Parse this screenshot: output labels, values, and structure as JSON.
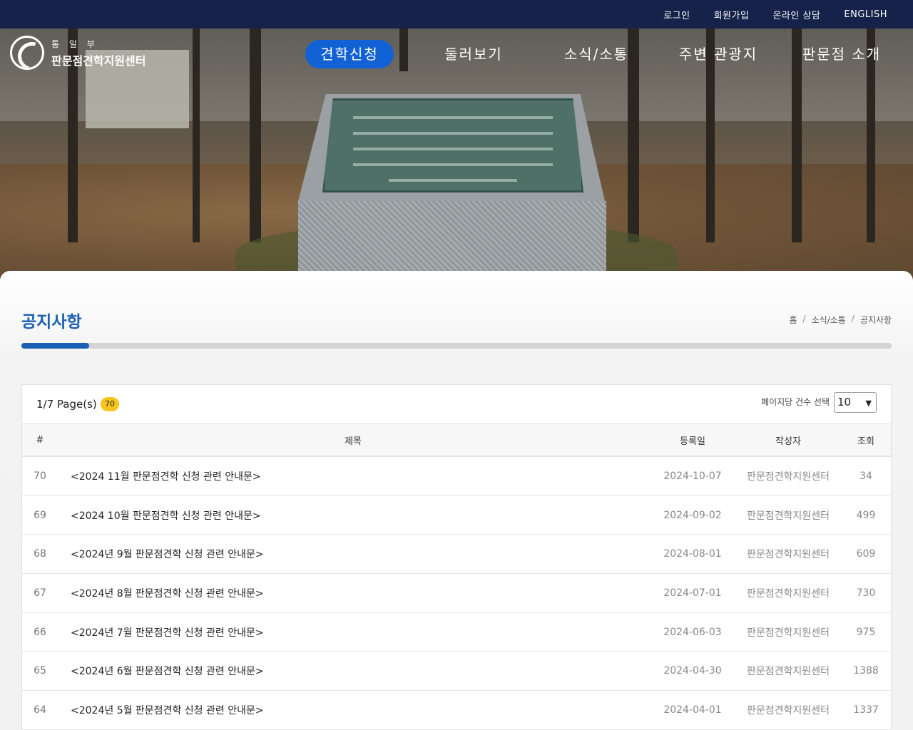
{
  "topbar": {
    "links": [
      "로그인",
      "회원가입",
      "온라인 상담",
      "ENGLISH"
    ]
  },
  "logo": {
    "ministry": "통 일 부",
    "center": "판문점견학지원센터"
  },
  "nav": {
    "items": [
      "견학신청",
      "둘러보기",
      "소식/소통",
      "주변 관광지",
      "판문점 소개"
    ],
    "active_index": 0
  },
  "page": {
    "title": "공지사항",
    "breadcrumb": [
      "홈",
      "소식/소통",
      "공지사항"
    ],
    "progress": 0.078
  },
  "board": {
    "page_info": "1/7 Page(s)",
    "total_count": "70",
    "per_page_label": "페이지당 건수 선택",
    "per_page_value": "10",
    "columns": {
      "num": "#",
      "title": "제목",
      "date": "등록일",
      "author": "작성자",
      "views": "조회"
    },
    "rows": [
      {
        "num": "70",
        "title": "<2024 11월 판문점견학 신청 관련 안내문>",
        "date": "2024-10-07",
        "author": "판문점견학지원센터",
        "views": "34"
      },
      {
        "num": "69",
        "title": "<2024 10월 판문점견학 신청 관련 안내문>",
        "date": "2024-09-02",
        "author": "판문점견학지원센터",
        "views": "499"
      },
      {
        "num": "68",
        "title": "<2024년 9월 판문점견학 신청 관련 안내문>",
        "date": "2024-08-01",
        "author": "판문점견학지원센터",
        "views": "609"
      },
      {
        "num": "67",
        "title": "<2024년 8월 판문점견학 신청 관련 안내문>",
        "date": "2024-07-01",
        "author": "판문점견학지원센터",
        "views": "730"
      },
      {
        "num": "66",
        "title": "<2024년 7월 판문점견학 신청 관련 안내문>",
        "date": "2024-06-03",
        "author": "판문점견학지원센터",
        "views": "975"
      },
      {
        "num": "65",
        "title": "<2024년 6월 판문점견학 신청 관련 안내문>",
        "date": "2024-04-30",
        "author": "판문점견학지원센터",
        "views": "1388"
      },
      {
        "num": "64",
        "title": "<2024년 5월 판문점견학 신청 관련 안내문>",
        "date": "2024-04-01",
        "author": "판문점견학지원센터",
        "views": "1337"
      }
    ]
  },
  "icons": {
    "logo": "government-emblem-icon",
    "select_arrow": "chevron-down-icon"
  },
  "colors": {
    "topbar": "#16224a",
    "accent": "#1262d6",
    "title": "#1a5fb4",
    "badge": "#f7c51e"
  }
}
